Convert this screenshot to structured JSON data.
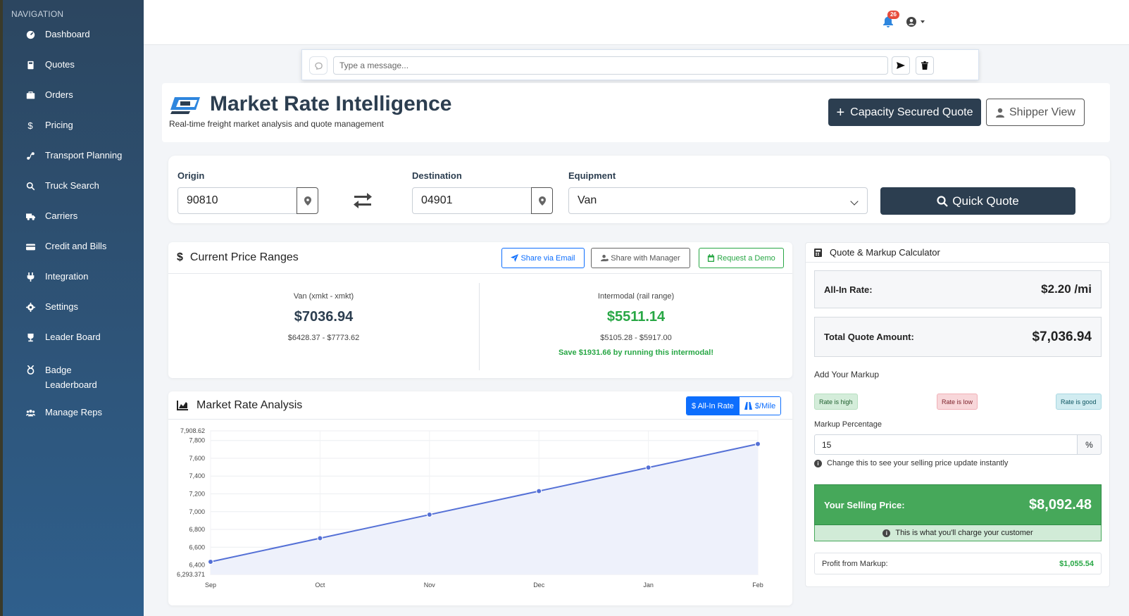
{
  "sidebar": {
    "title": "NAVIGATION",
    "items": [
      {
        "label": "Dashboard",
        "icon": "dashboard-icon"
      },
      {
        "label": "Quotes",
        "icon": "calculator-icon"
      },
      {
        "label": "Orders",
        "icon": "briefcase-icon"
      },
      {
        "label": "Pricing",
        "icon": "dollar-icon"
      },
      {
        "label": "Transport Planning",
        "icon": "route-icon"
      },
      {
        "label": "Truck Search",
        "icon": "search-icon"
      },
      {
        "label": "Carriers",
        "icon": "truck-icon"
      },
      {
        "label": "Credit and Bills",
        "icon": "credit-card-icon"
      },
      {
        "label": "Integration",
        "icon": "plug-icon"
      },
      {
        "label": "Settings",
        "icon": "gear-icon"
      },
      {
        "label": "Leader Board",
        "icon": "trophy-icon"
      },
      {
        "label": "Badge Leaderboard",
        "icon": "award-icon"
      },
      {
        "label": "Manage Reps",
        "icon": "users-icon"
      }
    ]
  },
  "header": {
    "notification_count": "26"
  },
  "chat": {
    "placeholder": "Type a message..."
  },
  "page": {
    "title": "Market Rate Intelligence",
    "subtitle": "Real-time freight market analysis and quote management",
    "capacity_button": "Capacity Secured Quote",
    "shipper_button": "Shipper View"
  },
  "search": {
    "origin_label": "Origin",
    "origin_value": "90810",
    "destination_label": "Destination",
    "destination_value": "04901",
    "equipment_label": "Equipment",
    "equipment_value": "Van",
    "quick_quote_label": "Quick Quote"
  },
  "price_ranges": {
    "title": "Current Price Ranges",
    "share_email": "Share via Email",
    "share_manager": "Share with Manager",
    "request_demo": "Request a Demo",
    "van": {
      "label": "Van (xmkt - xmkt)",
      "value": "$7036.94",
      "range": "$6428.37 - $7773.62"
    },
    "intermodal": {
      "label": "Intermodal (rail range)",
      "value": "$5511.14",
      "range": "$5105.28 - $5917.00",
      "savings": "Save $1931.66 by running this intermodal!"
    }
  },
  "analysis": {
    "title": "Market Rate Analysis",
    "toggle_all_in": "$ All-In Rate",
    "toggle_per_mile": "$/Mile"
  },
  "chart_data": {
    "type": "area",
    "categories": [
      "Sep",
      "Oct",
      "Nov",
      "Dec",
      "Jan",
      "Feb"
    ],
    "series": [
      {
        "values": [
          6436,
          6701,
          6966,
          7231,
          7496,
          7761
        ]
      }
    ],
    "ylim": [
      6293.371,
      7908.62
    ],
    "yticks": [
      "7,908.62",
      "7,800",
      "7,600",
      "7,400",
      "7,200",
      "7,000",
      "6,800",
      "6,600",
      "6,400",
      "6,293.371"
    ],
    "ytick_values": [
      7908.62,
      7800,
      7600,
      7400,
      7200,
      7000,
      6800,
      6600,
      6400,
      6293.371
    ],
    "line_color": "#5470d6",
    "fill_color": "#eef1fb",
    "grid": true
  },
  "calculator": {
    "title": "Quote & Markup Calculator",
    "all_in_label": "All-In Rate:",
    "all_in_value": "$2.20 /mi",
    "total_label": "Total Quote Amount:",
    "total_value": "$7,036.94",
    "add_markup_label": "Add Your Markup",
    "pill_high": "Rate is high",
    "pill_low": "Rate is low",
    "pill_good": "Rate is good",
    "markup_pct_label": "Markup Percentage",
    "markup_value": "15",
    "pct_symbol": "%",
    "hint": "Change this to see your selling price update instantly",
    "selling_label": "Your Selling Price:",
    "selling_value": "$8,092.48",
    "selling_note": "This is what you'll charge your customer",
    "profit_label": "Profit from Markup:",
    "profit_value": "$1,055.54"
  }
}
